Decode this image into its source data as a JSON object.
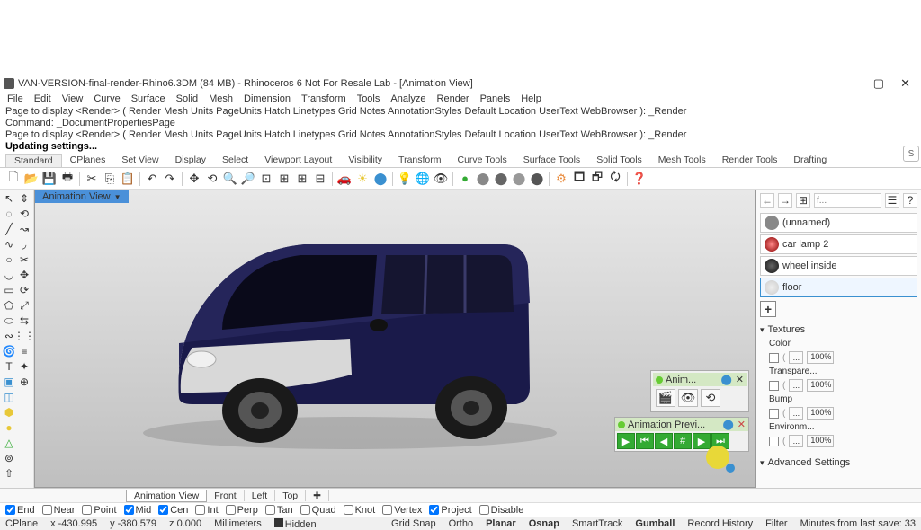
{
  "title": "VAN-VERSION-final-render-Rhino6.3DM (84 MB) - Rhinoceros 6 Not For Resale Lab - [Animation View]",
  "menu": [
    "File",
    "Edit",
    "View",
    "Curve",
    "Surface",
    "Solid",
    "Mesh",
    "Dimension",
    "Transform",
    "Tools",
    "Analyze",
    "Render",
    "Panels",
    "Help"
  ],
  "cmd1": "Page to display <Render> ( Render  Mesh  Units  PageUnits  Hatch  Linetypes  Grid  Notes  AnnotationStyles  Default  Location  UserText  WebBrowser ): _Render",
  "cmd2": "Command: _DocumentPropertiesPage",
  "cmd3": "Page to display <Render> ( Render  Mesh  Units  PageUnits  Hatch  Linetypes  Grid  Notes  AnnotationStyles  Default  Location  UserText  WebBrowser ): _Render",
  "cmd4": "Updating settings...",
  "tabs": [
    "Standard",
    "CPlanes",
    "Set View",
    "Display",
    "Select",
    "Viewport Layout",
    "Visibility",
    "Transform",
    "Curve Tools",
    "Surface Tools",
    "Solid Tools",
    "Mesh Tools",
    "Render Tools",
    "Drafting"
  ],
  "vp_label": "Animation View",
  "anim_label": "Anim...",
  "anim_prev_label": "Animation Previ...",
  "materials": {
    "m0": "(unnamed)",
    "m1": "car lamp 2",
    "m2": "wheel inside",
    "m3": "floor"
  },
  "search_ph": "f...",
  "textures_hdr": "Textures",
  "tex": {
    "color": "Color",
    "transpare": "Transpare...",
    "bump": "Bump",
    "env": "Environm..."
  },
  "pct": "100%",
  "adv": "Advanced Settings",
  "bot_tabs": [
    "Animation View",
    "Front",
    "Left",
    "Top"
  ],
  "snaps": {
    "end": "End",
    "near": "Near",
    "point": "Point",
    "mid": "Mid",
    "cen": "Cen",
    "int": "Int",
    "perp": "Perp",
    "tan": "Tan",
    "quad": "Quad",
    "knot": "Knot",
    "vertex": "Vertex",
    "project": "Project",
    "disable": "Disable"
  },
  "status": {
    "cplane": "CPlane",
    "x": "x -430.995",
    "y": "y -380.579",
    "z": "z 0.000",
    "mm": "Millimeters",
    "hidden": "Hidden",
    "gridsnap": "Grid Snap",
    "ortho": "Ortho",
    "planar": "Planar",
    "osnap": "Osnap",
    "smart": "SmartTrack",
    "gumball": "Gumball",
    "rec": "Record History",
    "filter": "Filter",
    "last": "Minutes from last save: 33"
  }
}
